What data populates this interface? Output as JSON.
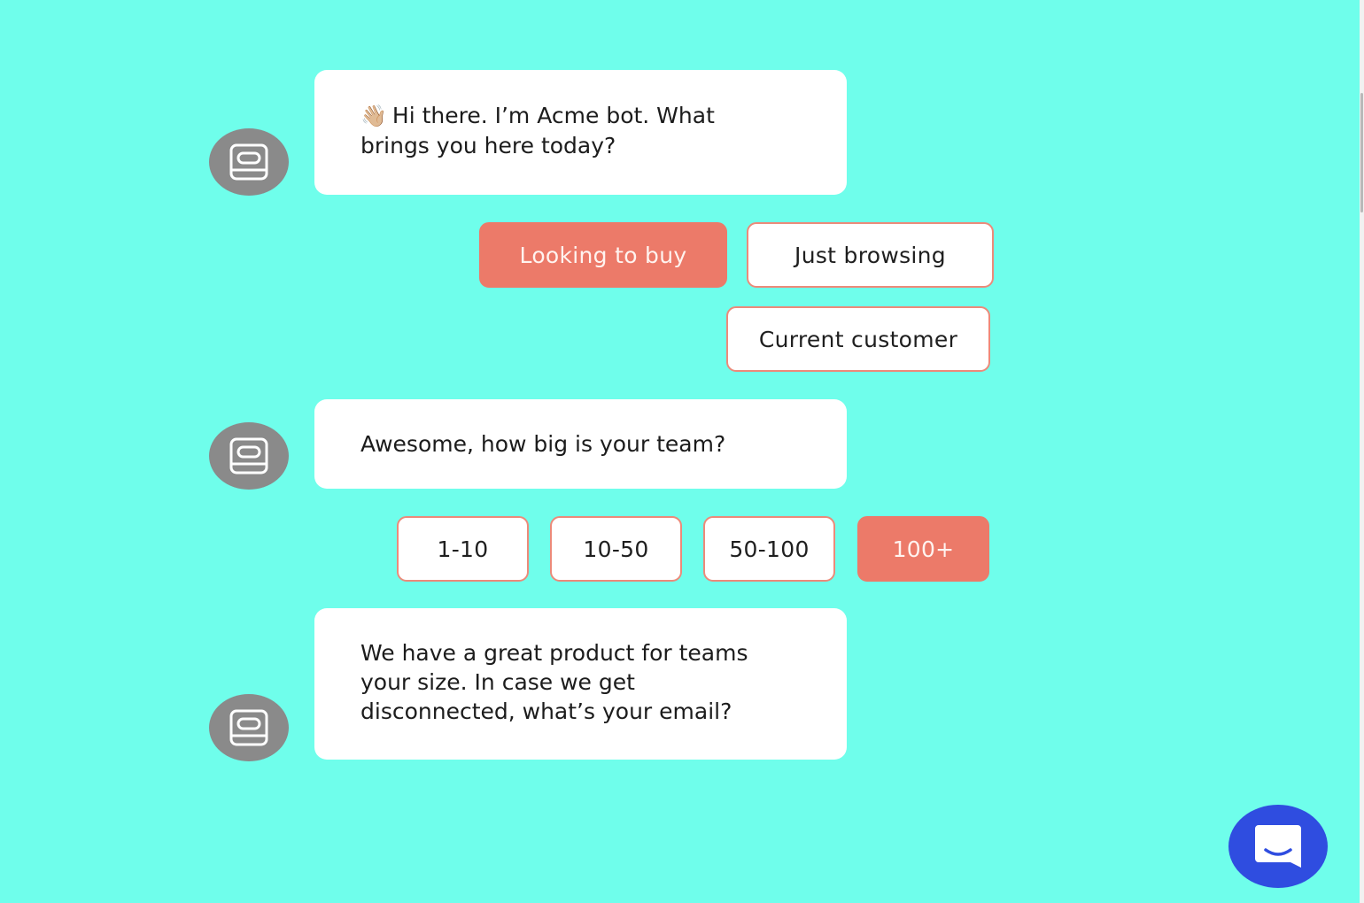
{
  "colors": {
    "background": "#6ffeeb",
    "accent": "#ec7a69",
    "avatar": "#8a8a8a",
    "launcher": "#2f4de0"
  },
  "bot": {
    "avatar_icon": "bot-device-icon"
  },
  "messages": [
    {
      "emoji": "👋🏼",
      "text": "Hi there. I’m Acme bot. What brings you here today?"
    },
    {
      "text": "Awesome, how big is your team?"
    },
    {
      "text": "We have a great product for teams your size. In case we get disconnected, what’s your email?"
    }
  ],
  "intent_options": [
    {
      "label": "Looking to buy",
      "selected": true
    },
    {
      "label": "Just browsing",
      "selected": false
    },
    {
      "label": "Current customer",
      "selected": false
    }
  ],
  "team_size_options": [
    {
      "label": "1-10",
      "selected": false
    },
    {
      "label": "10-50",
      "selected": false
    },
    {
      "label": "50-100",
      "selected": false
    },
    {
      "label": "100+",
      "selected": true
    }
  ],
  "launcher": {
    "icon": "chat-bubble-smile-icon"
  }
}
